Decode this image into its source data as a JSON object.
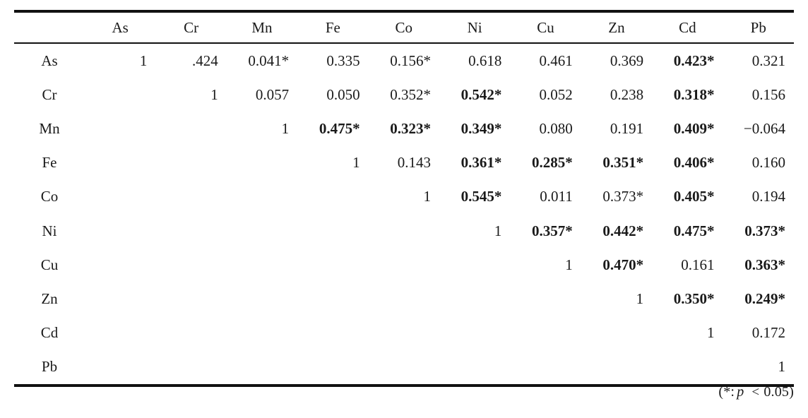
{
  "table": {
    "corner_label": "",
    "column_headers": [
      "As",
      "Cr",
      "Mn",
      "Fe",
      "Co",
      "Ni",
      "Cu",
      "Zn",
      "Cd",
      "Pb"
    ],
    "row_labels": [
      "As",
      "Cr",
      "Mn",
      "Fe",
      "Co",
      "Ni",
      "Cu",
      "Zn",
      "Cd",
      "Pb"
    ],
    "rows": [
      {
        "label": "As",
        "cells": [
          {
            "text": "1",
            "bold": false
          },
          {
            "text": ".424",
            "bold": false
          },
          {
            "text": "0.041*",
            "bold": false
          },
          {
            "text": "0.335",
            "bold": false
          },
          {
            "text": "0.156*",
            "bold": false
          },
          {
            "text": "0.618",
            "bold": false
          },
          {
            "text": "0.461",
            "bold": false
          },
          {
            "text": "0.369",
            "bold": false
          },
          {
            "text": "0.423*",
            "bold": true
          },
          {
            "text": "0.321",
            "bold": false
          }
        ]
      },
      {
        "label": "Cr",
        "cells": [
          {
            "text": "",
            "bold": false
          },
          {
            "text": "1",
            "bold": false
          },
          {
            "text": "0.057",
            "bold": false
          },
          {
            "text": "0.050",
            "bold": false
          },
          {
            "text": "0.352*",
            "bold": false
          },
          {
            "text": "0.542*",
            "bold": true
          },
          {
            "text": "0.052",
            "bold": false
          },
          {
            "text": "0.238",
            "bold": false
          },
          {
            "text": "0.318*",
            "bold": true
          },
          {
            "text": "0.156",
            "bold": false
          }
        ]
      },
      {
        "label": "Mn",
        "cells": [
          {
            "text": "",
            "bold": false
          },
          {
            "text": "",
            "bold": false
          },
          {
            "text": "1",
            "bold": false
          },
          {
            "text": "0.475*",
            "bold": true
          },
          {
            "text": "0.323*",
            "bold": true
          },
          {
            "text": "0.349*",
            "bold": true
          },
          {
            "text": "0.080",
            "bold": false
          },
          {
            "text": "0.191",
            "bold": false
          },
          {
            "text": "0.409*",
            "bold": true
          },
          {
            "text": "−0.064",
            "bold": false
          }
        ]
      },
      {
        "label": "Fe",
        "cells": [
          {
            "text": "",
            "bold": false
          },
          {
            "text": "",
            "bold": false
          },
          {
            "text": "",
            "bold": false
          },
          {
            "text": "1",
            "bold": false
          },
          {
            "text": "0.143",
            "bold": false
          },
          {
            "text": "0.361*",
            "bold": true
          },
          {
            "text": "0.285*",
            "bold": true
          },
          {
            "text": "0.351*",
            "bold": true
          },
          {
            "text": "0.406*",
            "bold": true
          },
          {
            "text": "0.160",
            "bold": false
          }
        ]
      },
      {
        "label": "Co",
        "cells": [
          {
            "text": "",
            "bold": false
          },
          {
            "text": "",
            "bold": false
          },
          {
            "text": "",
            "bold": false
          },
          {
            "text": "",
            "bold": false
          },
          {
            "text": "1",
            "bold": false
          },
          {
            "text": "0.545*",
            "bold": true
          },
          {
            "text": "0.011",
            "bold": false
          },
          {
            "text": "0.373*",
            "bold": false
          },
          {
            "text": "0.405*",
            "bold": true
          },
          {
            "text": "0.194",
            "bold": false
          }
        ]
      },
      {
        "label": "Ni",
        "cells": [
          {
            "text": "",
            "bold": false
          },
          {
            "text": "",
            "bold": false
          },
          {
            "text": "",
            "bold": false
          },
          {
            "text": "",
            "bold": false
          },
          {
            "text": "",
            "bold": false
          },
          {
            "text": "1",
            "bold": false
          },
          {
            "text": "0.357*",
            "bold": true
          },
          {
            "text": "0.442*",
            "bold": true
          },
          {
            "text": "0.475*",
            "bold": true
          },
          {
            "text": "0.373*",
            "bold": true
          }
        ]
      },
      {
        "label": "Cu",
        "cells": [
          {
            "text": "",
            "bold": false
          },
          {
            "text": "",
            "bold": false
          },
          {
            "text": "",
            "bold": false
          },
          {
            "text": "",
            "bold": false
          },
          {
            "text": "",
            "bold": false
          },
          {
            "text": "",
            "bold": false
          },
          {
            "text": "1",
            "bold": false
          },
          {
            "text": "0.470*",
            "bold": true
          },
          {
            "text": "0.161",
            "bold": false
          },
          {
            "text": "0.363*",
            "bold": true
          }
        ]
      },
      {
        "label": "Zn",
        "cells": [
          {
            "text": "",
            "bold": false
          },
          {
            "text": "",
            "bold": false
          },
          {
            "text": "",
            "bold": false
          },
          {
            "text": "",
            "bold": false
          },
          {
            "text": "",
            "bold": false
          },
          {
            "text": "",
            "bold": false
          },
          {
            "text": "",
            "bold": false
          },
          {
            "text": "1",
            "bold": false
          },
          {
            "text": "0.350*",
            "bold": true
          },
          {
            "text": "0.249*",
            "bold": true
          }
        ]
      },
      {
        "label": "Cd",
        "cells": [
          {
            "text": "",
            "bold": false
          },
          {
            "text": "",
            "bold": false
          },
          {
            "text": "",
            "bold": false
          },
          {
            "text": "",
            "bold": false
          },
          {
            "text": "",
            "bold": false
          },
          {
            "text": "",
            "bold": false
          },
          {
            "text": "",
            "bold": false
          },
          {
            "text": "",
            "bold": false
          },
          {
            "text": "1",
            "bold": false
          },
          {
            "text": "0.172",
            "bold": false
          }
        ]
      },
      {
        "label": "Pb",
        "cells": [
          {
            "text": "",
            "bold": false
          },
          {
            "text": "",
            "bold": false
          },
          {
            "text": "",
            "bold": false
          },
          {
            "text": "",
            "bold": false
          },
          {
            "text": "",
            "bold": false
          },
          {
            "text": "",
            "bold": false
          },
          {
            "text": "",
            "bold": false
          },
          {
            "text": "",
            "bold": false
          },
          {
            "text": "",
            "bold": false
          },
          {
            "text": "1",
            "bold": false
          }
        ]
      }
    ]
  },
  "footnote": {
    "open": "(*:",
    "variable": "p",
    "operator": "<",
    "value": "0.05)"
  },
  "chart_data": {
    "type": "table",
    "title": "",
    "categories": [
      "As",
      "Cr",
      "Mn",
      "Fe",
      "Co",
      "Ni",
      "Cu",
      "Zn",
      "Cd",
      "Pb"
    ],
    "matrix_form": "upper-triangular",
    "series": [
      {
        "name": "As",
        "values": [
          1,
          0.424,
          0.041,
          0.335,
          0.156,
          0.618,
          0.461,
          0.369,
          0.423,
          0.321
        ]
      },
      {
        "name": "Cr",
        "values": [
          null,
          1,
          0.057,
          0.05,
          0.352,
          0.542,
          0.052,
          0.238,
          0.318,
          0.156
        ]
      },
      {
        "name": "Mn",
        "values": [
          null,
          null,
          1,
          0.475,
          0.323,
          0.349,
          0.08,
          0.191,
          0.409,
          -0.064
        ]
      },
      {
        "name": "Fe",
        "values": [
          null,
          null,
          null,
          1,
          0.143,
          0.361,
          0.285,
          0.351,
          0.406,
          0.16
        ]
      },
      {
        "name": "Co",
        "values": [
          null,
          null,
          null,
          null,
          1,
          0.545,
          0.011,
          0.373,
          0.405,
          0.194
        ]
      },
      {
        "name": "Ni",
        "values": [
          null,
          null,
          null,
          null,
          null,
          1,
          0.357,
          0.442,
          0.475,
          0.373
        ]
      },
      {
        "name": "Cu",
        "values": [
          null,
          null,
          null,
          null,
          null,
          null,
          1,
          0.47,
          0.161,
          0.363
        ]
      },
      {
        "name": "Zn",
        "values": [
          null,
          null,
          null,
          null,
          null,
          null,
          null,
          1,
          0.35,
          0.249
        ]
      },
      {
        "name": "Cd",
        "values": [
          null,
          null,
          null,
          null,
          null,
          null,
          null,
          null,
          1,
          0.172
        ]
      },
      {
        "name": "Pb",
        "values": [
          null,
          null,
          null,
          null,
          null,
          null,
          null,
          null,
          null,
          1
        ]
      }
    ],
    "significant_marker": "*",
    "significance_note": "(*: p < 0.05)",
    "xlabel": "",
    "ylabel": "",
    "grid": false,
    "legend": "none"
  }
}
